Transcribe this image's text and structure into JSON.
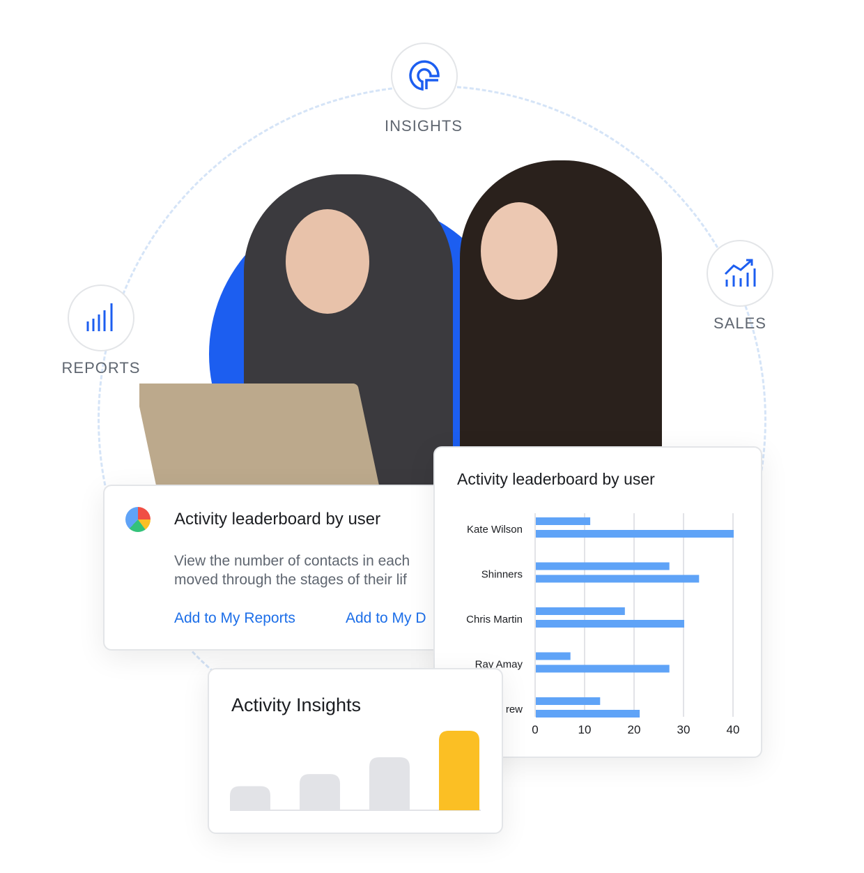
{
  "nodes": {
    "insights": "INSIGHTS",
    "sales": "SALES",
    "reports": "REPORTS"
  },
  "colors": {
    "accent": "#1c5ef0",
    "bar": "#5fa3f7",
    "highlight": "#fbbf24",
    "muted_bar": "#e2e3e7"
  },
  "info_card": {
    "title": "Activity leaderboard by user",
    "description_line1": "View the number of contacts in each",
    "description_line2": "moved through the stages of their lif",
    "link1": "Add to My Reports",
    "link2": "Add to My D",
    "icon": "pie-chart-icon"
  },
  "insights_card": {
    "title": "Activity Insights"
  },
  "chart_data": {
    "type": "bar",
    "orientation": "horizontal",
    "title": "Activity leaderboard by user",
    "categories": [
      "Kate Wilson",
      "Shinners",
      "Chris Martin",
      "Ray Amay",
      "rew"
    ],
    "series": [
      {
        "values": [
          11,
          27,
          18,
          7,
          13
        ]
      },
      {
        "values": [
          40,
          33,
          30,
          27,
          21
        ]
      }
    ],
    "xlim": [
      0,
      40
    ],
    "xticks": [
      "0",
      "10",
      "20",
      "30",
      "40"
    ],
    "grid": true
  },
  "insights_chart": {
    "type": "bar",
    "values": [
      1,
      1.5,
      2.2,
      3.3
    ],
    "highlight_index": 3
  }
}
